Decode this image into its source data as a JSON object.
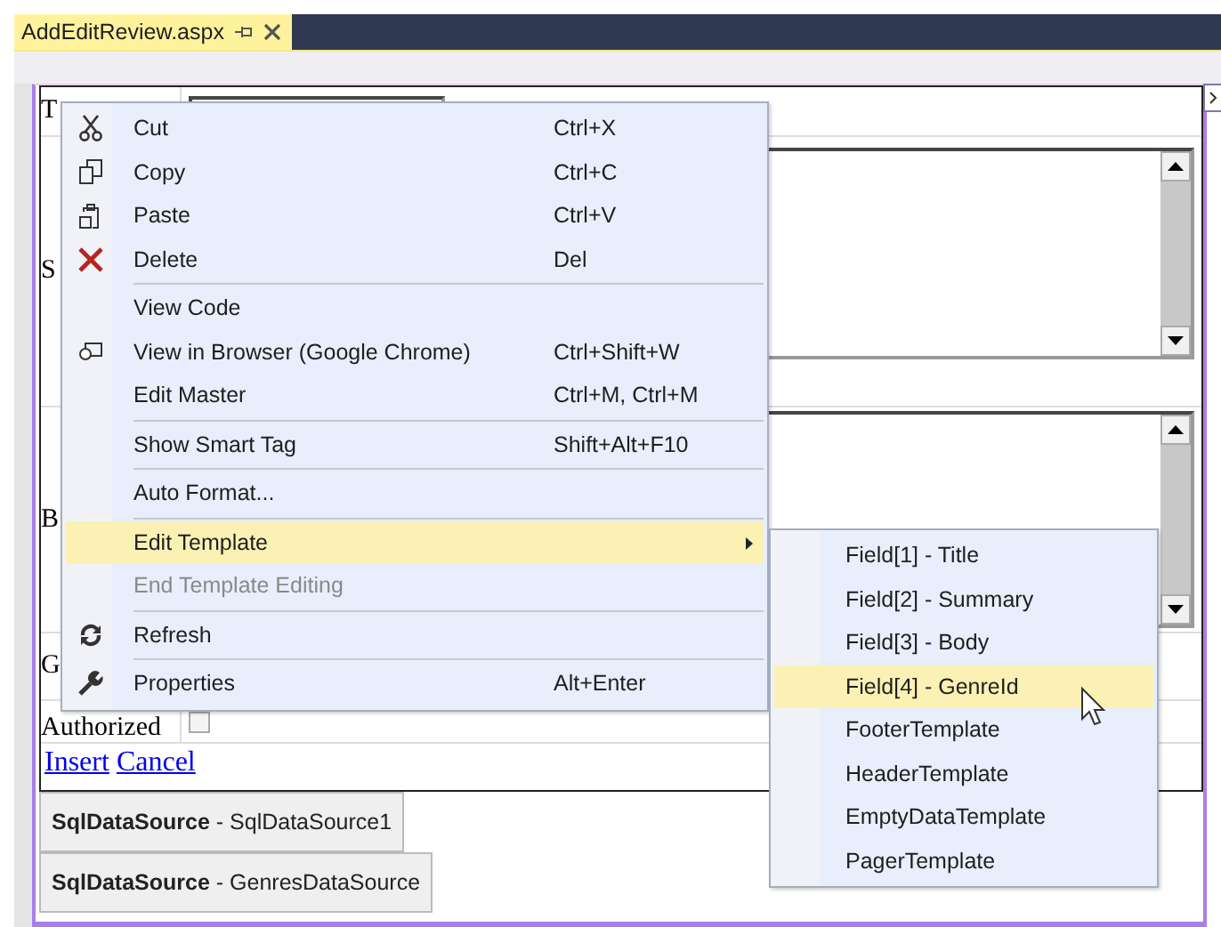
{
  "tab": {
    "title": "AddEditReview.aspx",
    "selected": true
  },
  "form": {
    "rows": [
      {
        "label": "T",
        "kind": "input"
      },
      {
        "label": "S",
        "kind": "textarea"
      },
      {
        "label": "B",
        "kind": "textarea"
      },
      {
        "label": "G",
        "kind": "plain"
      },
      {
        "label": "Authorized",
        "kind": "checkbox",
        "checked": false
      }
    ],
    "links": [
      "Insert",
      "Cancel"
    ]
  },
  "data_sources": [
    "**SqlDataSource** - SqlDataSource1",
    "**SqlDataSource** - GenresDataSource"
  ],
  "context_menu": {
    "items": [
      {
        "kind": "item",
        "label": "Cut",
        "shortcut": "Ctrl+X",
        "disabled": false,
        "selected": false
      },
      {
        "kind": "item",
        "label": "Copy",
        "shortcut": "Ctrl+C",
        "disabled": false,
        "selected": false
      },
      {
        "kind": "item",
        "label": "Paste",
        "shortcut": "Ctrl+V",
        "disabled": false,
        "selected": false
      },
      {
        "kind": "item",
        "label": "Delete",
        "shortcut": "Del",
        "disabled": false,
        "selected": false
      },
      {
        "kind": "separator"
      },
      {
        "kind": "item",
        "label": "View Code",
        "disabled": false,
        "selected": false
      },
      {
        "kind": "item",
        "label": "View in Browser (Google Chrome)",
        "shortcut": "Ctrl+Shift+W",
        "disabled": false,
        "selected": false
      },
      {
        "kind": "item",
        "label": "Edit Master",
        "shortcut": "Ctrl+M, Ctrl+M",
        "disabled": false,
        "selected": false
      },
      {
        "kind": "separator"
      },
      {
        "kind": "item",
        "label": "Show Smart Tag",
        "shortcut": "Shift+Alt+F10",
        "disabled": false,
        "selected": false
      },
      {
        "kind": "separator"
      },
      {
        "kind": "item",
        "label": "Auto Format...",
        "disabled": false,
        "selected": false
      },
      {
        "kind": "separator"
      },
      {
        "kind": "submenu",
        "label": "Edit Template",
        "disabled": false,
        "selected": true
      },
      {
        "kind": "item",
        "label": "End Template Editing",
        "disabled": true,
        "selected": false
      },
      {
        "kind": "separator"
      },
      {
        "kind": "item",
        "label": "Refresh",
        "disabled": false,
        "selected": false
      },
      {
        "kind": "separator"
      },
      {
        "kind": "item",
        "label": "Properties",
        "shortcut": "Alt+Enter",
        "disabled": false,
        "selected": false
      }
    ]
  },
  "submenu": {
    "items": [
      {
        "label": "Field[1] - Title",
        "selected": false
      },
      {
        "label": "Field[2] - Summary",
        "selected": false
      },
      {
        "label": "Field[3] - Body",
        "selected": false
      },
      {
        "label": "Field[4] - GenreId",
        "selected": true
      },
      {
        "label": "FooterTemplate",
        "selected": false
      },
      {
        "label": "HeaderTemplate",
        "selected": false
      },
      {
        "label": "EmptyDataTemplate",
        "selected": false
      },
      {
        "label": "PagerTemplate",
        "selected": false
      }
    ]
  }
}
